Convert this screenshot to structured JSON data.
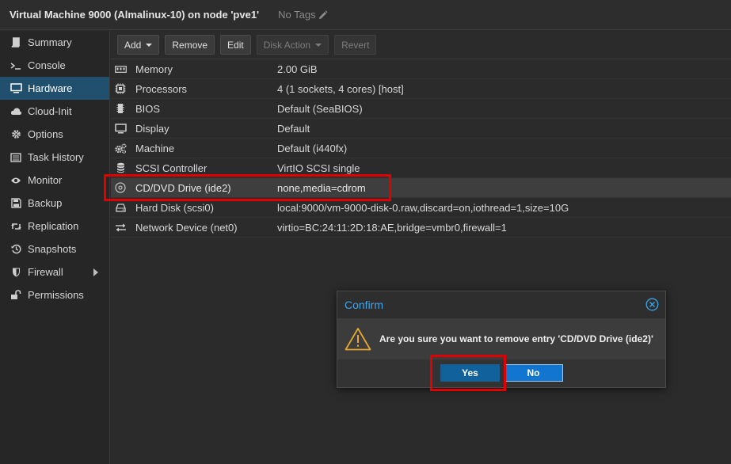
{
  "header": {
    "title": "Virtual Machine 9000 (Almalinux-10) on node 'pve1'",
    "tags": "No Tags"
  },
  "sidebar": {
    "items": [
      {
        "label": "Summary",
        "icon": "book-icon"
      },
      {
        "label": "Console",
        "icon": "terminal-icon"
      },
      {
        "label": "Hardware",
        "icon": "monitor-icon"
      },
      {
        "label": "Cloud-Init",
        "icon": "cloud-icon"
      },
      {
        "label": "Options",
        "icon": "gear-icon"
      },
      {
        "label": "Task History",
        "icon": "list-icon"
      },
      {
        "label": "Monitor",
        "icon": "eye-icon"
      },
      {
        "label": "Backup",
        "icon": "floppy-icon"
      },
      {
        "label": "Replication",
        "icon": "retweet-icon"
      },
      {
        "label": "Snapshots",
        "icon": "history-icon"
      },
      {
        "label": "Firewall",
        "icon": "shield-icon"
      },
      {
        "label": "Permissions",
        "icon": "unlock-icon"
      }
    ],
    "active": "Hardware"
  },
  "toolbar": {
    "add": "Add",
    "remove": "Remove",
    "edit": "Edit",
    "disk_action": "Disk Action",
    "revert": "Revert"
  },
  "hardware": [
    {
      "name": "Memory",
      "value": "2.00 GiB",
      "icon": "memory-icon"
    },
    {
      "name": "Processors",
      "value": "4 (1 sockets, 4 cores) [host]",
      "icon": "cpu-icon"
    },
    {
      "name": "BIOS",
      "value": "Default (SeaBIOS)",
      "icon": "microchip-icon"
    },
    {
      "name": "Display",
      "value": "Default",
      "icon": "desktop-icon"
    },
    {
      "name": "Machine",
      "value": "Default (i440fx)",
      "icon": "cogs-icon"
    },
    {
      "name": "SCSI Controller",
      "value": "VirtIO SCSI single",
      "icon": "database-icon"
    },
    {
      "name": "CD/DVD Drive (ide2)",
      "value": "none,media=cdrom",
      "icon": "cdrom-icon"
    },
    {
      "name": "Hard Disk (scsi0)",
      "value": "local:9000/vm-9000-disk-0.raw,discard=on,iothread=1,size=10G",
      "icon": "hdd-icon"
    },
    {
      "name": "Network Device (net0)",
      "value": "virtio=BC:24:11:2D:18:AE,bridge=vmbr0,firewall=1",
      "icon": "exchange-icon"
    }
  ],
  "dialog": {
    "title": "Confirm",
    "message": "Are you sure you want to remove entry 'CD/DVD Drive (ide2)'",
    "yes": "Yes",
    "no": "No"
  },
  "colors": {
    "accent": "#3fa4e8",
    "active_nav": "#21506f",
    "highlight_box": "#e00000"
  }
}
